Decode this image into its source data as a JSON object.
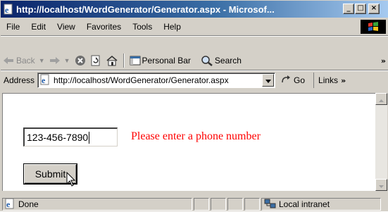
{
  "window": {
    "title": "http://localhost/WordGenerator/Generator.aspx - Microsof...",
    "controls": {
      "minimize": "_",
      "maximize": "□",
      "close": "×"
    }
  },
  "menu": {
    "items": [
      "File",
      "Edit",
      "View",
      "Favorites",
      "Tools",
      "Help"
    ]
  },
  "toolbar": {
    "back_label": "Back",
    "personal_bar_label": "Personal Bar",
    "search_label": "Search",
    "overflow": "»"
  },
  "address": {
    "label": "Address",
    "url": "http://localhost/WordGenerator/Generator.aspx",
    "go_label": "Go",
    "links_label": "Links",
    "links_overflow": "»"
  },
  "form": {
    "phone_value": "123-456-7890",
    "validation_message": "Please enter a phone number",
    "submit_label": "Submit"
  },
  "status": {
    "text": "Done",
    "zone": "Local intranet"
  },
  "colors": {
    "title_gradient_start": "#0a246a",
    "title_gradient_end": "#a6caf0",
    "chrome": "#d4d0c8",
    "validation": "#ff0000"
  },
  "icons": {
    "title": "ie-page-icon",
    "throbber": "windows-flag-icon",
    "back": "back-arrow-icon",
    "forward": "forward-arrow-icon",
    "stop": "stop-icon",
    "refresh": "refresh-icon",
    "home": "home-icon",
    "personal_bar": "personal-bar-icon",
    "search": "search-icon",
    "address_page": "ie-page-icon",
    "go": "go-arrow-icon",
    "status_page": "ie-page-icon",
    "zone": "local-intranet-icon"
  }
}
